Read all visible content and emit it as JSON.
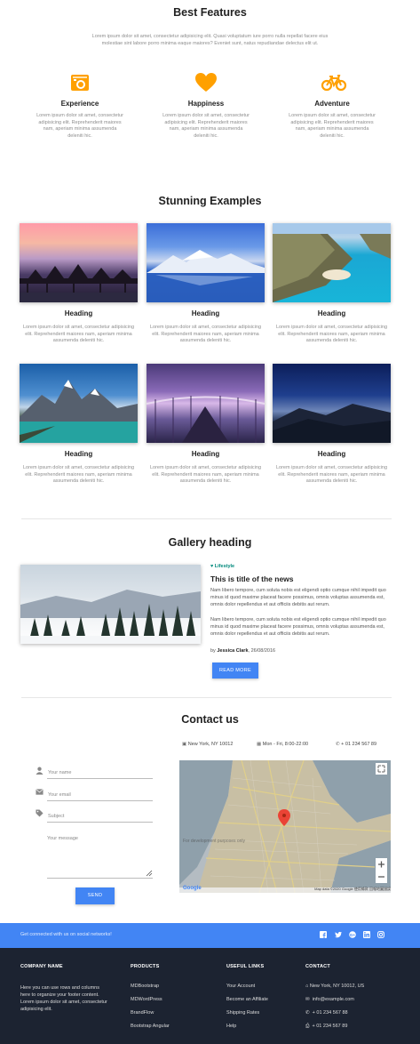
{
  "features": {
    "title": "Best Features",
    "intro": "Lorem ipsum dolor sit amet, consectetur adipisicing elit. Quasi voluptatum iure porro nulla repellat facere eius molestiae sint labore porro minima eaque maiores? Eveniet sunt, natus repudiandae delectus elit ut.",
    "items": [
      {
        "icon": "camera-icon",
        "title": "Experience",
        "text": "Lorem ipsum dolor sit amet, consectetur adipisicing elit. Reprehenderit maiores nam, aperiam minima assumenda deleniti hic."
      },
      {
        "icon": "heart-icon",
        "title": "Happiness",
        "text": "Lorem ipsum dolor sit amet, consectetur adipisicing elit. Reprehenderit maiores nam, aperiam minima assumenda deleniti hic."
      },
      {
        "icon": "bicycle-icon",
        "title": "Adventure",
        "text": "Lorem ipsum dolor sit amet, consectetur adipisicing elit. Reprehenderit maiores nam, aperiam minima assumenda deleniti hic."
      }
    ],
    "accent": "#ffa000"
  },
  "examples": {
    "title": "Stunning Examples",
    "items": [
      {
        "heading": "Heading",
        "text": "Lorem ipsum dolor sit amet, consectetur adipisicing elit. Reprehenderit maiores nam, aperiam minima assumenda deleniti hic."
      },
      {
        "heading": "Heading",
        "text": "Lorem ipsum dolor sit amet, consectetur adipisicing elit. Reprehenderit maiores nam, aperiam minima assumenda deleniti hic."
      },
      {
        "heading": "Heading",
        "text": "Lorem ipsum dolor sit amet, consectetur adipisicing elit. Reprehenderit maiores nam, aperiam minima assumenda deleniti hic."
      },
      {
        "heading": "Heading",
        "text": "Lorem ipsum dolor sit amet, consectetur adipisicing elit. Reprehenderit maiores nam, aperiam minima assumenda deleniti hic."
      },
      {
        "heading": "Heading",
        "text": "Lorem ipsum dolor sit amet, consectetur adipisicing elit. Reprehenderit maiores nam, aperiam minima assumenda deleniti hic."
      },
      {
        "heading": "Heading",
        "text": "Lorem ipsum dolor sit amet, consectetur adipisicing elit. Reprehenderit maiores nam, aperiam minima assumenda deleniti hic."
      }
    ]
  },
  "gallery": {
    "title": "Gallery heading",
    "category": "Lifestyle",
    "news_title": "This is title of the news",
    "p1": "Nam libero tempore, cum soluta nobis est eligendi optio cumque nihil impedit quo minus id quod maxime placeat facere possimus, omnis voluptas assumenda est, omnis dolor repellendus et aut officiis debitis aut rerum.",
    "p2": "Nam libero tempore, cum soluta nobis est eligendi optio cumque nihil impedit quo minus id quod maxime placeat facere possimus, omnis voluptas assumenda est, omnis dolor repellendus et aut officiis debitis aut rerum.",
    "by_prefix": "by",
    "author": "Jessica Clark",
    "date": ", 26/08/2016",
    "button": "READ MORE",
    "category_color": "#00897b"
  },
  "contact": {
    "title": "Contact us",
    "address": "New York, NY 10012",
    "hours": "Mon - Fri, 8:00-22:00",
    "phone": "+ 01 234 567 89",
    "name_ph": "Your name",
    "email_ph": "Your email",
    "subject_ph": "Subject",
    "message_ph": "Your message",
    "send": "SEND",
    "map_attribution": "Map data ©2020 Google  使用條款  回報地圖錯誤",
    "map_watermark": "For development purposes only"
  },
  "social": {
    "text": "Get connected with us on social networks!",
    "icons": [
      "facebook-icon",
      "twitter-icon",
      "google-plus-icon",
      "linkedin-icon",
      "instagram-icon"
    ],
    "color": "#4285f4"
  },
  "footer": {
    "company_title": "COMPANY NAME",
    "company_text": "Here you can use rows and columns here to organize your footer content. Lorem ipsum dolor sit amet, consectetur adipisicing elit.",
    "products_title": "PRODUCTS",
    "products": [
      "MDBootstrap",
      "MDWordPress",
      "BrandFlow",
      "Bootstrap Angular"
    ],
    "links_title": "USEFUL LINKS",
    "links": [
      "Your Account",
      "Become an Affiliate",
      "Shipping Rates",
      "Help"
    ],
    "contact_title": "CONTACT",
    "contact": [
      "New York, NY 10012, US",
      "info@example.com",
      "+ 01 234 567 88",
      "+ 01 234 567 89"
    ],
    "bg": "#1c2331"
  }
}
